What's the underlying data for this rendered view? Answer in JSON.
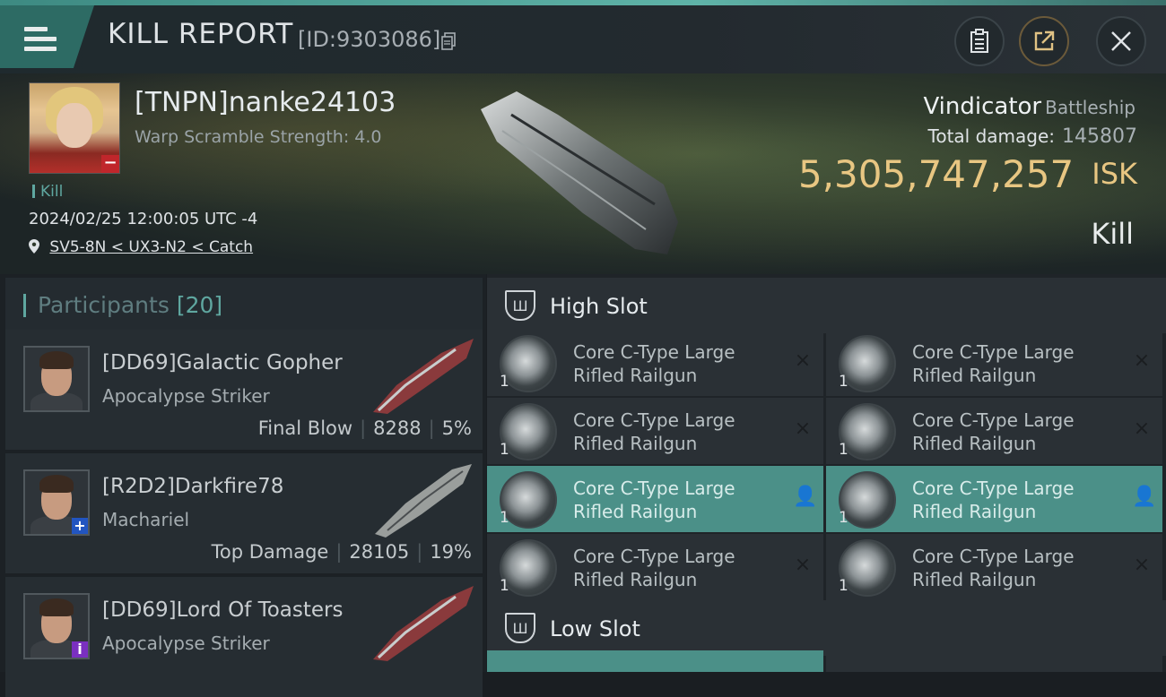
{
  "header": {
    "title": "KILL REPORT",
    "report_id": "[ID:9303086]"
  },
  "victim": {
    "name": "[TNPN]nanke24103",
    "warp_scramble": "Warp Scramble Strength: 4.0",
    "kill_tag": "Kill",
    "datetime": "2024/02/25 12:00:05 UTC -4",
    "location": "SV5-8N < UX3-N2 < Catch",
    "ship_name": "Vindicator",
    "ship_class": "Battleship",
    "total_damage_label": "Total damage:",
    "total_damage": "145807",
    "isk_value": "5,305,747,257",
    "isk_unit": "ISK",
    "status": "Kill"
  },
  "participants": {
    "label": "Participants",
    "count": "[20]",
    "items": [
      {
        "name": "[DD69]Galactic Gopher",
        "ship": "Apocalypse Striker",
        "role": "Final Blow",
        "damage": "8288",
        "percent": "5%"
      },
      {
        "name": "[R2D2]Darkfire78",
        "ship": "Machariel",
        "role": "Top Damage",
        "damage": "28105",
        "percent": "19%"
      },
      {
        "name": "[DD69]Lord Of Toasters",
        "ship": "Apocalypse Striker",
        "role": "",
        "damage": "",
        "percent": ""
      }
    ]
  },
  "slots": {
    "high_label": "High Slot",
    "low_label": "Low Slot",
    "high_modules": [
      {
        "line1": "Core C-Type Large",
        "line2": "Rifled Railgun",
        "qty": "1",
        "state": "×"
      },
      {
        "line1": "Core C-Type Large",
        "line2": "Rifled Railgun",
        "qty": "1",
        "state": "×"
      },
      {
        "line1": "Core C-Type Large",
        "line2": "Rifled Railgun",
        "qty": "1",
        "state": "×"
      },
      {
        "line1": "Core C-Type Large",
        "line2": "Rifled Railgun",
        "qty": "1",
        "state": "×"
      },
      {
        "line1": "Core C-Type Large",
        "line2": "Rifled Railgun",
        "qty": "1",
        "state": "👤"
      },
      {
        "line1": "Core C-Type Large",
        "line2": "Rifled Railgun",
        "qty": "1",
        "state": "👤"
      },
      {
        "line1": "Core C-Type Large",
        "line2": "Rifled Railgun",
        "qty": "1",
        "state": "×"
      },
      {
        "line1": "Core C-Type Large",
        "line2": "Rifled Railgun",
        "qty": "1",
        "state": "×"
      }
    ]
  },
  "colors": {
    "accent": "#5fa7a0",
    "isk": "#e8c682",
    "highlight_row": "#4b9088"
  },
  "icons": [
    "menu-icon",
    "copy-icon",
    "clipboard-icon",
    "share-icon",
    "close-icon",
    "location-pin-icon",
    "slot-icon"
  ]
}
